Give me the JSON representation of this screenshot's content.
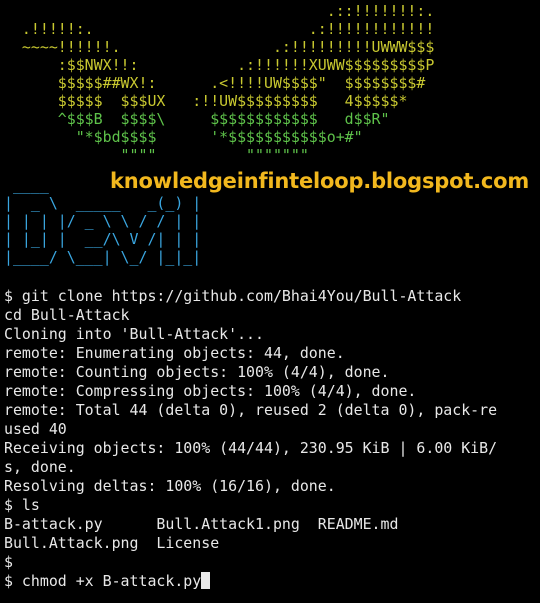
{
  "colors": {
    "background": "#000000",
    "text": "#e8e8e8",
    "art_green": "#5ec24a",
    "art_yellow": "#c8c830",
    "art_devil": "#3aa6e0",
    "watermark": "#f2b81e"
  },
  "banner": {
    "bull_art": [
      {
        "text": "                                    .::!!!!!!!:.",
        "color": "#c8c830"
      },
      {
        "text": "  .!!!!!:.                        .:!!!!!!!!!!!!",
        "color": "#c8c830"
      },
      {
        "text": "  ~~~~!!!!!!.                 .:!!!!!!!!!UWWW$$$",
        "color": "#c8c830"
      },
      {
        "text": "      :$$NWX!!:           .:!!!!!!XUWW$$$$$$$$$P",
        "color": "#c8c830"
      },
      {
        "text": "      $$$$$##WX!:      .<!!!!UW$$$$\"  $$$$$$$$#",
        "color": "#c8c830"
      },
      {
        "text": "      $$$$$  $$$UX   :!!UW$$$$$$$$$   4$$$$$*",
        "color": "#c8c830"
      },
      {
        "text": "      ^$$$B  $$$$\\     $$$$$$$$$$$$   d$$R\"",
        "color": "#5ec24a"
      },
      {
        "text": "        \"*$bd$$$$      '*$$$$$$$$$$$o+#\"",
        "color": "#5ec24a"
      },
      {
        "text": "             \"\"\"\"          \"\"\"\"\"\"\"",
        "color": "#5ec24a"
      }
    ],
    "devil_art": [
      " ____",
      "|  _ \\  _____   _(_) |",
      "| | | |/ _ \\ \\ / / | |",
      "| |_| |  __/\\ V /| | |",
      "|____/ \\___| \\_/ |_|_|"
    ],
    "watermark": "knowledgeinfinteloop.blogspot.com"
  },
  "terminal_output": [
    "$ git clone https://github.com/Bhai4You/Bull-Attack",
    "cd Bull-Attack",
    "Cloning into 'Bull-Attack'...",
    "remote: Enumerating objects: 44, done.",
    "remote: Counting objects: 100% (4/4), done.",
    "remote: Compressing objects: 100% (4/4), done.",
    "remote: Total 44 (delta 0), reused 2 (delta 0), pack-re",
    "used 40",
    "Receiving objects: 100% (44/44), 230.95 KiB | 6.00 KiB/",
    "s, done.",
    "Resolving deltas: 100% (16/16), done.",
    "$ ls",
    "B-attack.py      Bull.Attack1.png  README.md",
    "Bull.Attack.png  License",
    "$"
  ],
  "current_command": "$ chmod +x B-attack.py"
}
